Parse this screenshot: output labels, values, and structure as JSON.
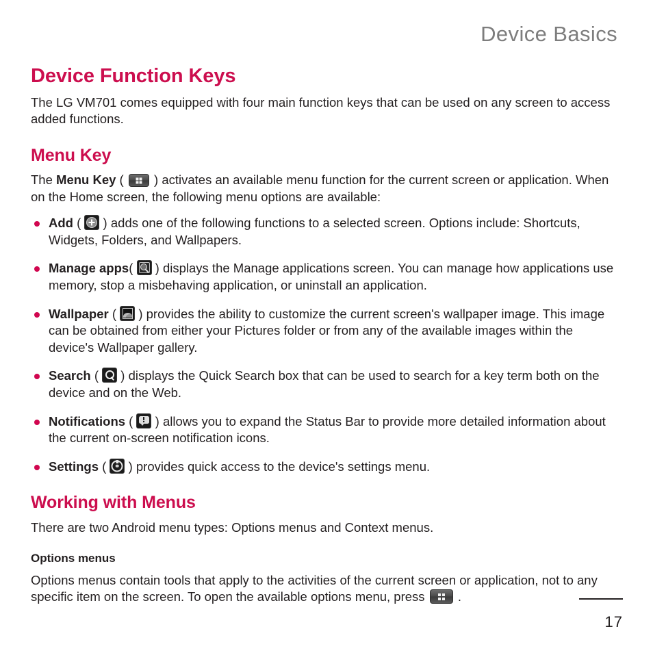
{
  "header": {
    "running_title": "Device Basics"
  },
  "main": {
    "title": "Device Function Keys",
    "intro": "The LG VM701 comes equipped with four main function keys that can be used on any screen to access added functions."
  },
  "menu_key_section": {
    "title": "Menu Key",
    "intro_before": "The ",
    "intro_bold": "Menu Key",
    "intro_paren_open": " ( ",
    "intro_paren_close": " ) ",
    "intro_after": "activates an available menu function for the current screen or application. When on the Home screen, the following menu options are available:",
    "options": [
      {
        "label": "Add",
        "icon": "add-icon",
        "paren_open": " ( ",
        "paren_close": " ) ",
        "description": "adds one of the following functions to a selected screen. Options include: Shortcuts, Widgets, Folders, and Wallpapers."
      },
      {
        "label": "Manage apps",
        "icon": "manage-apps-icon",
        "paren_open": "( ",
        "paren_close": " ) ",
        "description": "displays the Manage applications screen. You can manage how applications use memory, stop a misbehaving application, or uninstall an application."
      },
      {
        "label": "Wallpaper",
        "icon": "wallpaper-icon",
        "paren_open": " ( ",
        "paren_close": " ) ",
        "description": "provides the ability to customize the current screen's wallpaper image. This image can be obtained from either your Pictures folder or from any of the available images within the device's Wallpaper gallery."
      },
      {
        "label": "Search",
        "icon": "search-icon",
        "paren_open": " ( ",
        "paren_close": " ) ",
        "description": "displays the Quick Search box that can be used to search for a key term both on the device and on the Web."
      },
      {
        "label": "Notifications",
        "icon": "notifications-icon",
        "paren_open": " ( ",
        "paren_close": " ) ",
        "description": "allows you to expand the Status Bar to provide more detailed information about the current on-screen notification icons."
      },
      {
        "label": "Settings",
        "icon": "settings-icon",
        "paren_open": " ( ",
        "paren_close": " ) ",
        "description": "provides quick access to the device's settings menu."
      }
    ]
  },
  "working_with_menus": {
    "title": "Working with Menus",
    "intro": "There are two Android menu types: Options menus and Context menus.",
    "options_menus": {
      "title": "Options menus",
      "text_before": "Options menus contain tools that apply to the activities of the current screen or application, not to any specific item on the screen. To open the available options menu, press ",
      "text_after": " ."
    }
  },
  "footer": {
    "page_number": "17"
  },
  "colors": {
    "heading": "#cc0e4e",
    "bullet": "#d1064f",
    "body_text": "#231f20",
    "running_header": "#7d7d7d"
  }
}
